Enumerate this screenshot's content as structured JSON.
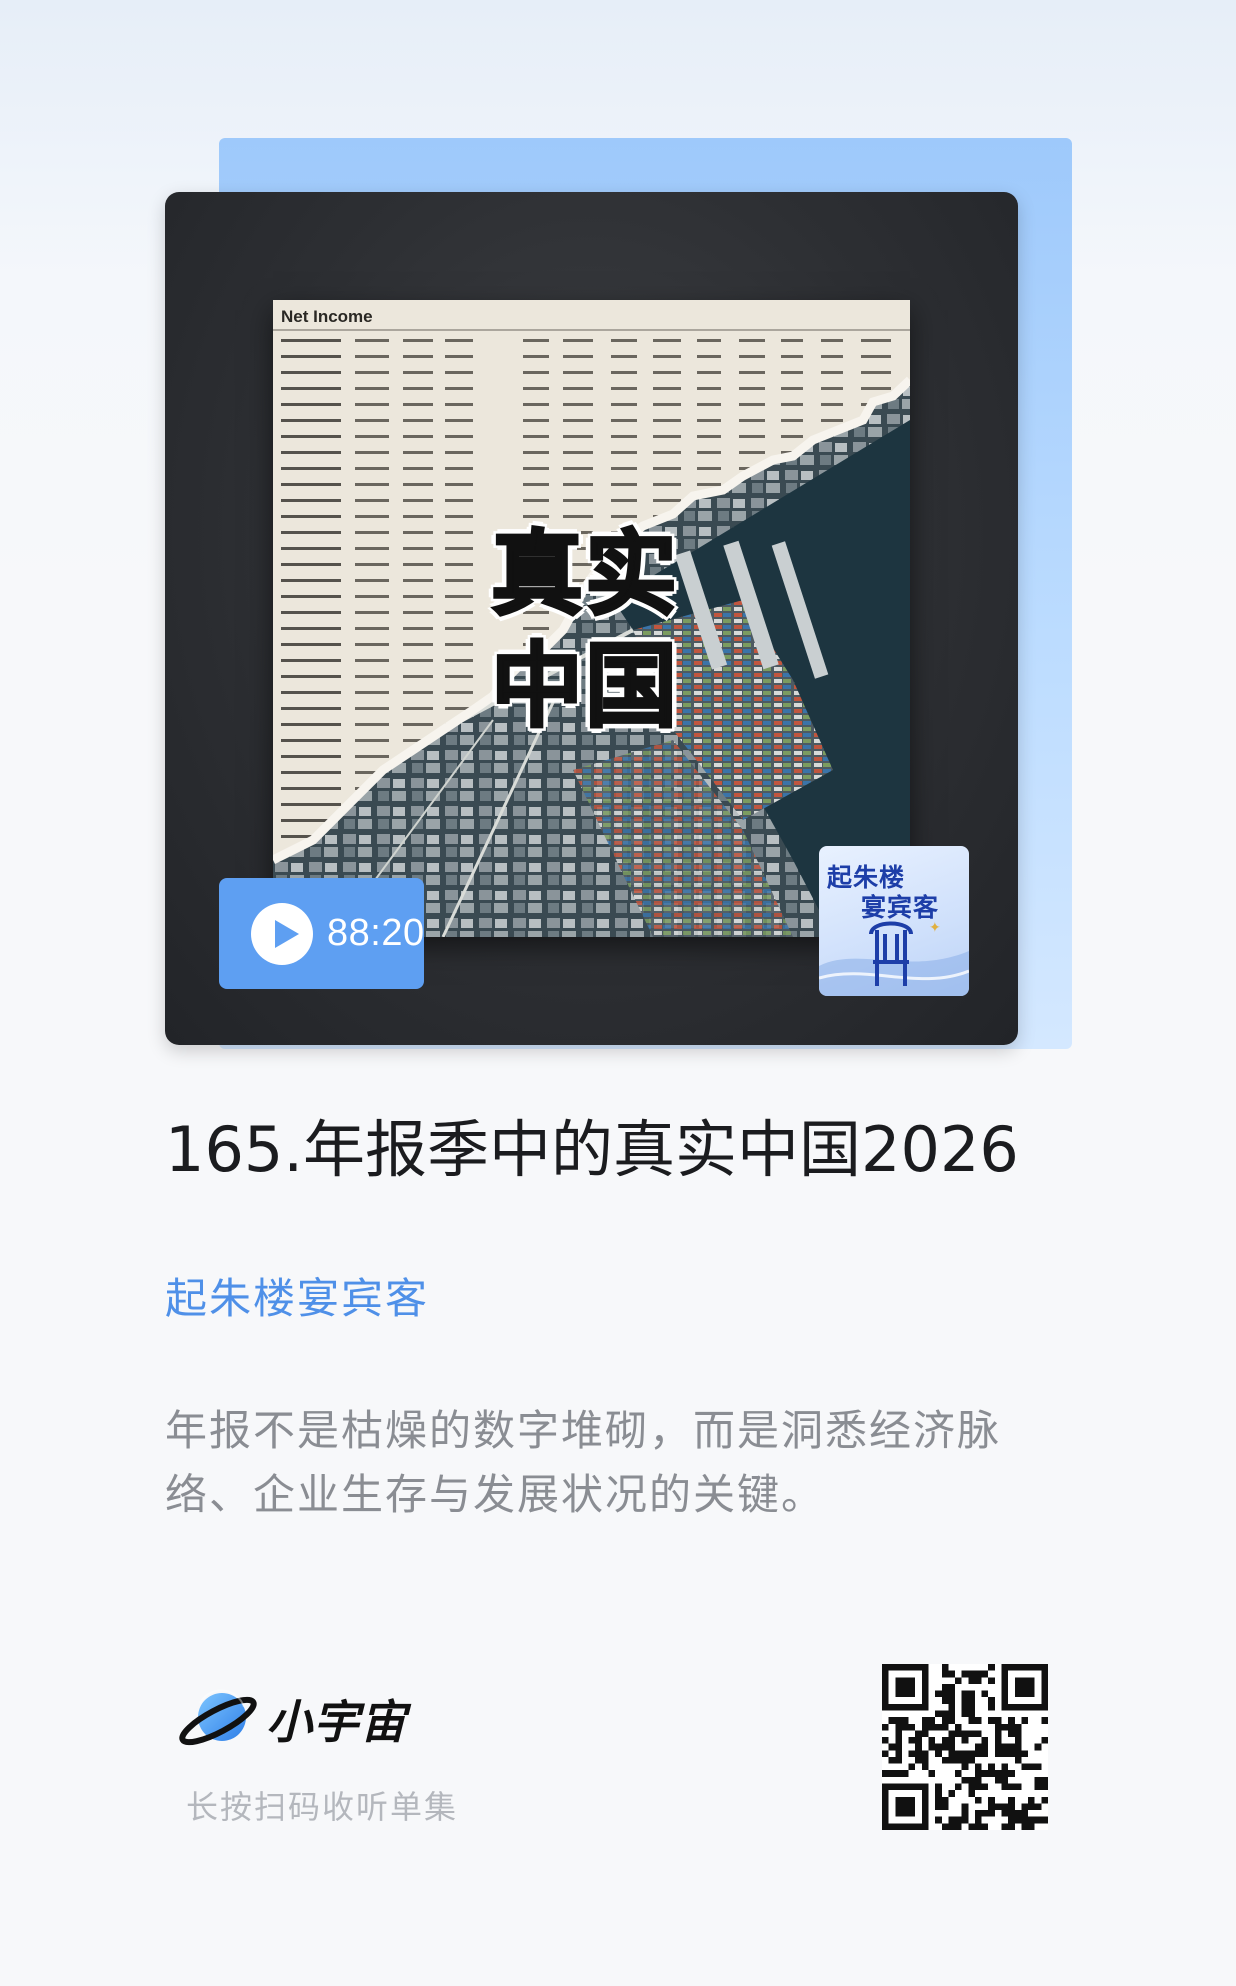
{
  "cover": {
    "art_title_line1": "真实",
    "art_title_line2": "中国",
    "paper_heading": "Net Income",
    "logo_line1": "起朱楼",
    "logo_line2": "宴宾客",
    "duration": "88:20"
  },
  "episode": {
    "title": "165.年报季中的真实中国2026",
    "podcast_name": "起朱楼宴宾客",
    "description": "年报不是枯燥的数字堆砌，而是洞悉经济脉络、企业生存与发展状况的关键。"
  },
  "footer": {
    "brand_name": "小宇宙",
    "scan_hint": "长按扫码收听单集",
    "qr_icon": "qr-code"
  },
  "colors": {
    "accent": "#5e9ff2",
    "podcast_link": "#4f90e8",
    "title": "#1b1c1f",
    "description": "#8a8d93"
  }
}
